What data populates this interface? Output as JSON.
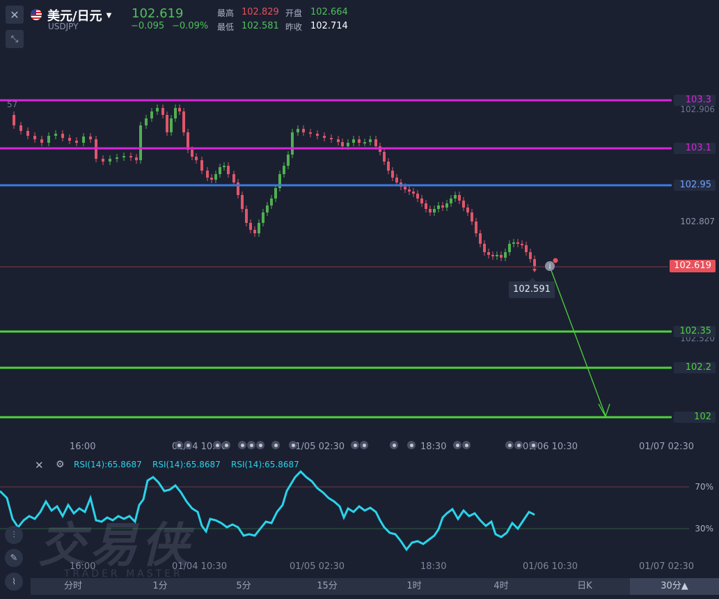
{
  "header": {
    "pair_name": "美元/日元",
    "symbol": "USDJPY",
    "last_price": "102.619",
    "change": "−0.095",
    "change_pct": "−0.09%",
    "high_label": "最高",
    "high_value": "102.829",
    "open_label": "开盘",
    "open_value": "102.664",
    "low_label": "最低",
    "low_value": "102.581",
    "prev_close_label": "昨收",
    "prev_close_value": "102.714"
  },
  "price_axis": {
    "left_partial": "57",
    "tick_mid": "102.807",
    "tick_low": "102.520",
    "tick_high": "102.906",
    "current_price_tag": "102.619",
    "hover_tooltip": "102.591"
  },
  "levels": [
    {
      "label": "103.3",
      "color": "#d726d7"
    },
    {
      "label": "103.1",
      "color": "#d726d7"
    },
    {
      "label": "102.95",
      "color": "#3b7be0"
    },
    {
      "label": "102.35",
      "color": "#4ed33a"
    },
    {
      "label": "102.2",
      "color": "#4ed33a"
    },
    {
      "label": "102",
      "color": "#4ed33a"
    }
  ],
  "time_axis": {
    "labels": [
      "16:00",
      "01/04 10:30",
      "01/05 02:30",
      "18:30",
      "01/06 10:30",
      "01/07 02:30"
    ]
  },
  "rsi": {
    "label_1": "RSI(14):65.8687",
    "label_2": "RSI(14):65.8687",
    "label_3": "RSI(14):65.8687",
    "level_high": "70%",
    "level_low": "30%",
    "time_labels": [
      "16:00",
      "01/04 10:30",
      "01/05 02:30",
      "18:30",
      "01/06 10:30",
      "01/07 02:30"
    ]
  },
  "watermark": {
    "brand_cn": "交易侠",
    "brand_en": "TRADER MASTER"
  },
  "timeframes": {
    "tabs": [
      "分时",
      "1分",
      "5分",
      "15分",
      "1时",
      "4时",
      "日K"
    ],
    "selected": "30分▲"
  },
  "colors": {
    "background": "#1b2031",
    "bull": "#4fb04f",
    "bear": "#e0566a",
    "rsi_line": "#2ad4ea",
    "price_tag": "#e8515b",
    "arrow": "#4ed33a"
  }
}
